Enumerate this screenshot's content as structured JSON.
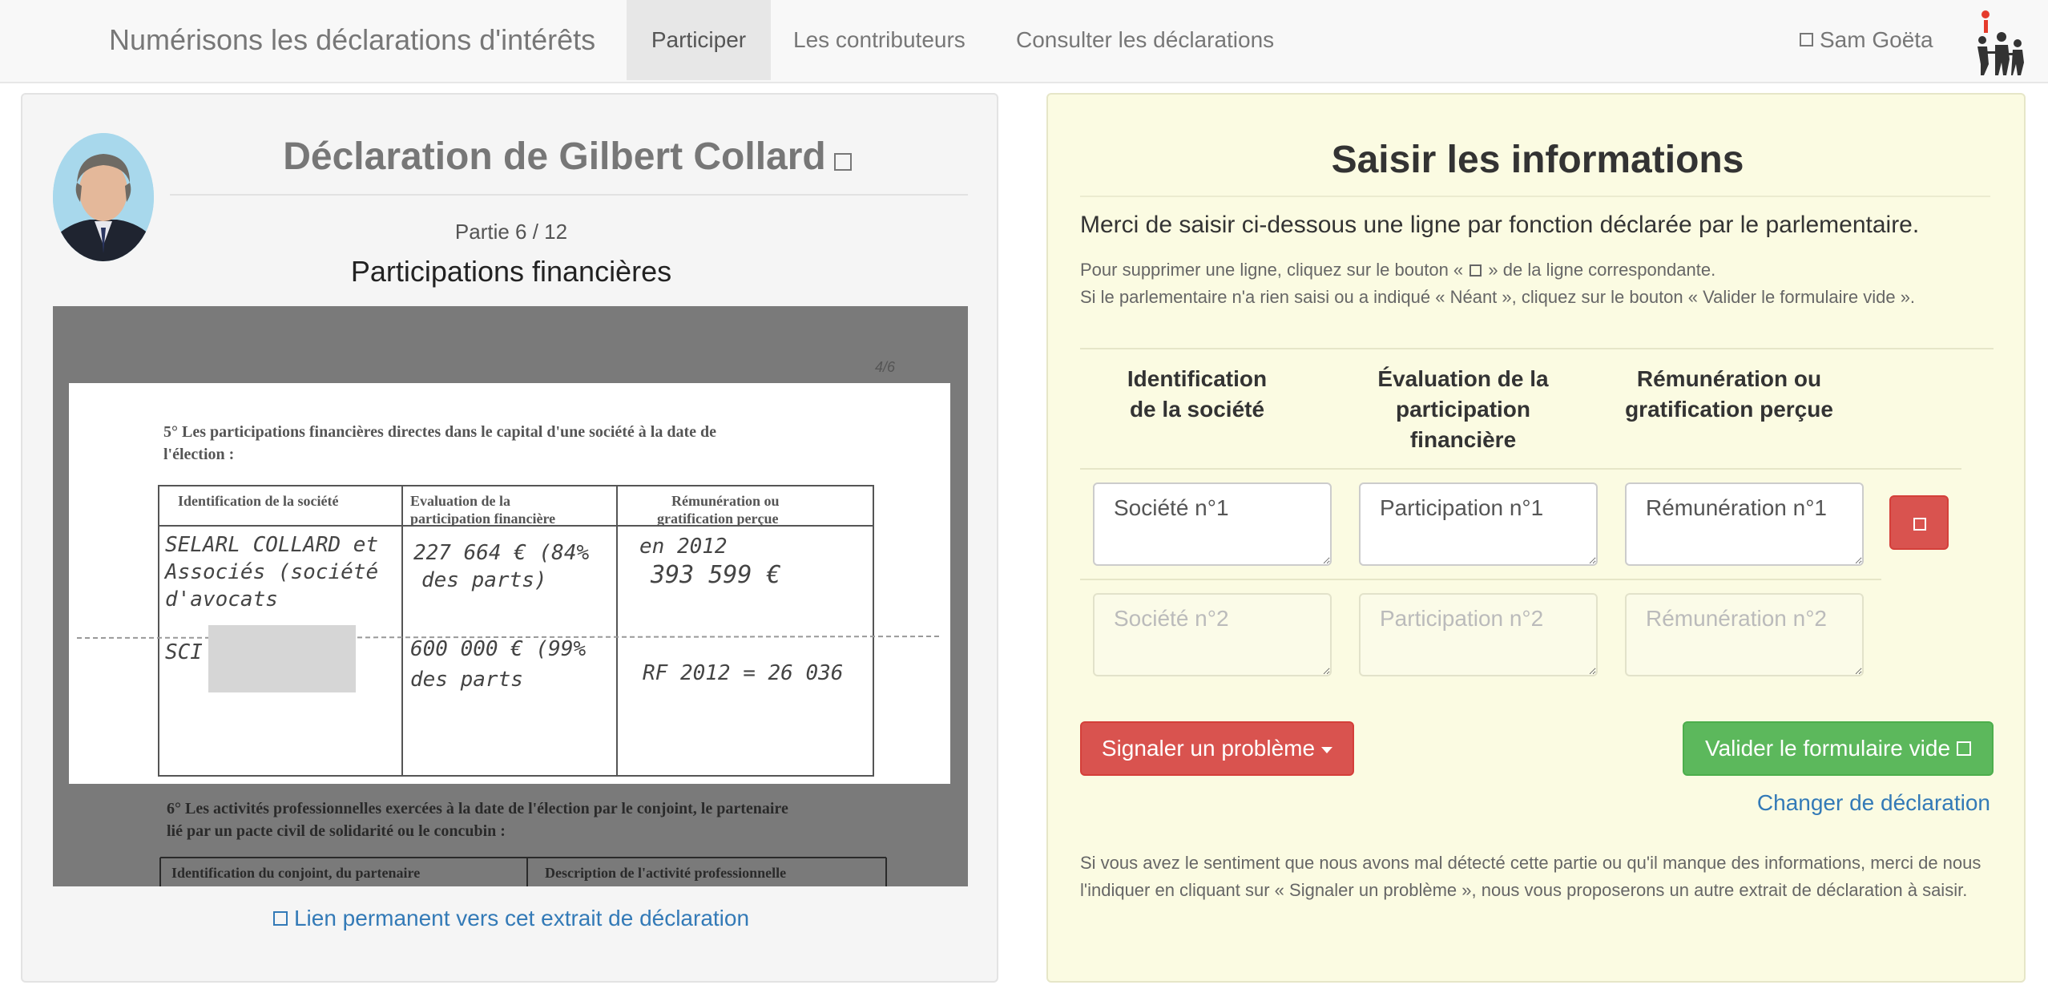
{
  "navbar": {
    "brand": "Numérisons les déclarations d'intérêts",
    "items": [
      "Participer",
      "Les contributeurs",
      "Consulter les déclarations"
    ],
    "active": "Participer",
    "user": "Sam Goëta",
    "user_icon": "user-icon",
    "logo_icon": "family-logo-icon"
  },
  "declaration": {
    "title": "Déclaration de Gilbert Collard",
    "title_icon": "external-link-icon",
    "partie": "Partie 6 / 12",
    "section": "Participations financières",
    "permalink": "Lien permanent vers cet extrait de déclaration",
    "permalink_icon": "link-icon",
    "scan": {
      "page_no": "4/6",
      "heading_line1": "5° Les participations financières directes dans le capital d'une société à la date de",
      "heading_line2": "l'élection :",
      "col1": "Identification de la société",
      "col2_line1": "Evaluation        de        la",
      "col2_line2": "participation financière",
      "col3_line1": "Rémunération ou",
      "col3_line2": "gratification perçue",
      "r1c1_l1": "SELARL COLLARD et",
      "r1c1_l2": "Associés (société",
      "r1c1_l3": "d'avocats",
      "r1c2_l1": "227 664 € (84%",
      "r1c2_l2": "des parts)",
      "r1c3_l1": "en 2012",
      "r1c3_l2": "393 599 €",
      "r2c1": "SCI",
      "r2c2_l1": "600 000 € (99%",
      "r2c2_l2": "des parts",
      "r2c3": "RF 2012 = 26 036",
      "next_heading_line1": "6° Les activités professionnelles exercées à la date de l'élection par le conjoint, le partenaire",
      "next_heading_line2": "lié par un pacte civil de solidarité ou le concubin :",
      "next_col1": "Identification du conjoint, du partenaire",
      "next_col2": "Description de l'activité professionnelle"
    }
  },
  "form": {
    "title": "Saisir les informations",
    "intro": "Merci de saisir ci-dessous une ligne par fonction déclarée par le parlementaire.",
    "help_line1_a": "Pour supprimer une ligne, cliquez sur le bouton «",
    "help_line1_b": "» de la ligne correspondante.",
    "help_line2": "Si le parlementaire n'a rien saisi ou a indiqué « Néant », cliquez sur le bouton « Valider le formulaire vide ».",
    "columns": {
      "col1_l1": "Identification",
      "col1_l2": "de la société",
      "col2_l1": "Évaluation de la",
      "col2_l2": "participation",
      "col2_l3": "financière",
      "col3_l1": "Rémunération ou",
      "col3_l2": "gratification perçue"
    },
    "rows": [
      {
        "societe": "Société n°1",
        "participation": "Participation n°1",
        "remuneration": "Rémunération n°1"
      },
      {
        "societe": "Société n°2",
        "participation": "Participation n°2",
        "remuneration": "Rémunération n°2"
      }
    ],
    "delete_icon": "trash-icon",
    "report_button": "Signaler un problème",
    "validate_button": "Valider le formulaire vide",
    "validate_icon": "check-icon",
    "change_link": "Changer de déclaration",
    "footer_note": "Si vous avez le sentiment que nous avons mal détecté cette partie ou qu'il manque des informations, merci de nous l'indiquer en cliquant sur « Signaler un problème », nous vous proposerons un autre extrait de déclaration à saisir."
  },
  "colors": {
    "navbar_bg": "#f8f8f8",
    "right_panel_bg": "#fbfbe2",
    "left_panel_bg": "#f5f5f5",
    "danger": "#d9534f",
    "success": "#5cb85c",
    "link": "#337ab7"
  }
}
